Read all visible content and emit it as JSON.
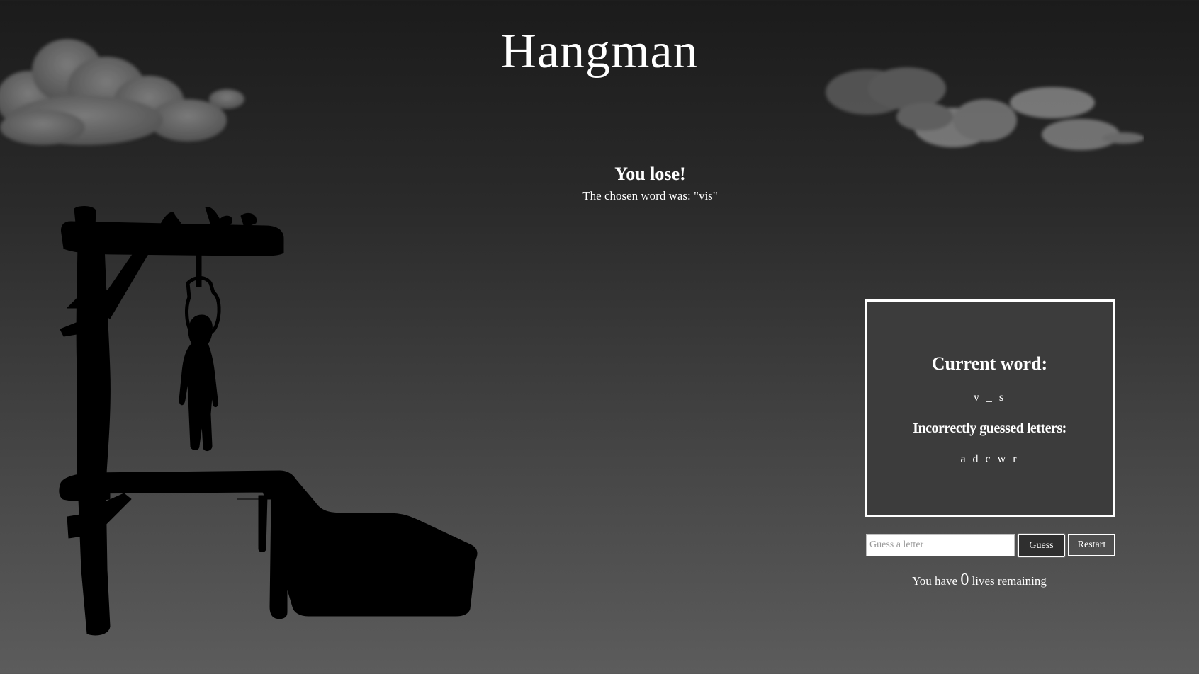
{
  "title": "Hangman",
  "result": {
    "heading": "You lose!",
    "detail": "The chosen word was: \"vis\""
  },
  "panel": {
    "current_heading": "Current word:",
    "current_word": "v _ s",
    "wrong_heading": "Incorrectly guessed letters:",
    "wrong_letters": "a d c w r"
  },
  "controls": {
    "guess_placeholder": "Guess a letter",
    "guess_value": "",
    "guess_label": "Guess",
    "restart_label": "Restart"
  },
  "lives": {
    "prefix": "You have",
    "count": "0",
    "suffix": "lives remaining"
  },
  "colors": {
    "background_top": "#1b1b1b",
    "background_bottom": "#5c5c5c",
    "panel": "#3c3c3c",
    "text": "#ffffff",
    "silhouette": "#000000"
  }
}
